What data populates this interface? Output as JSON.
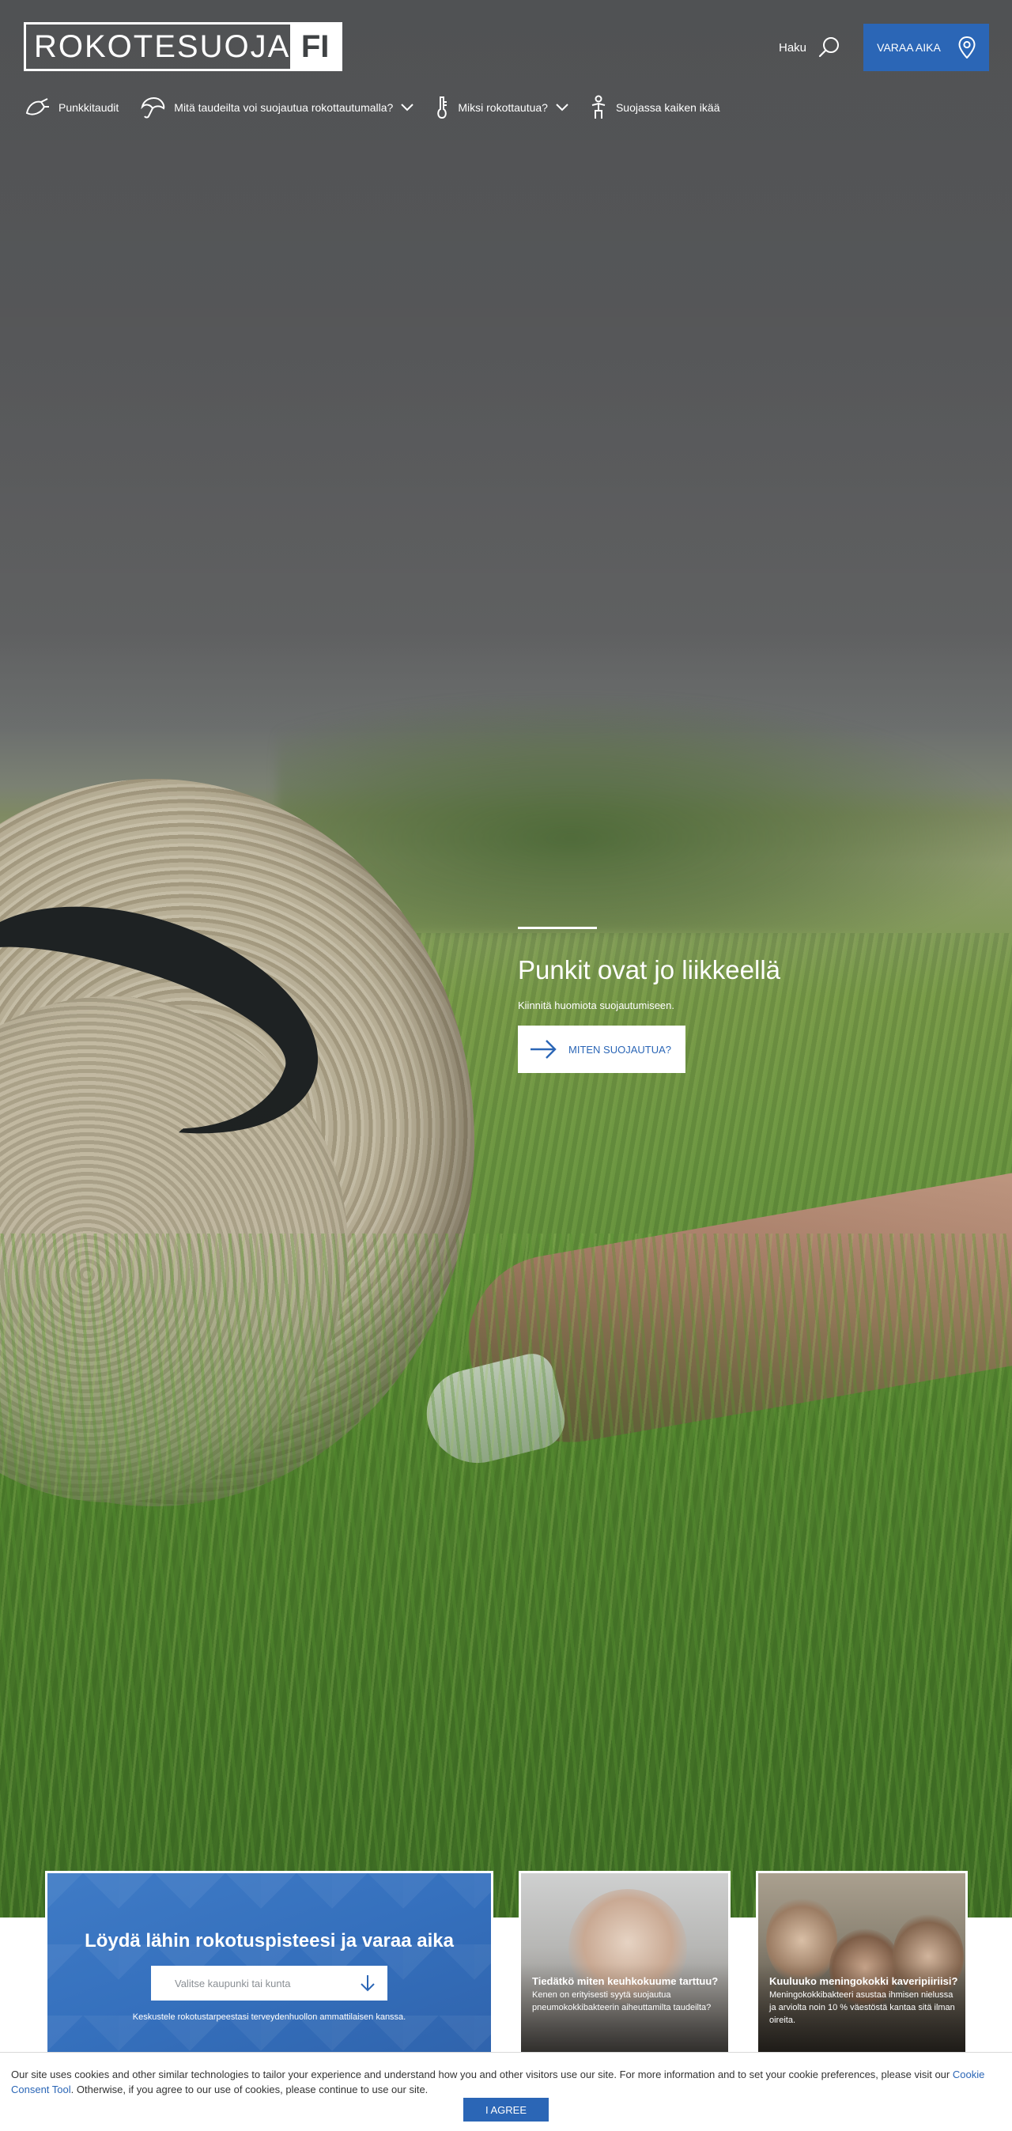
{
  "header": {
    "logo_text": "ROKOTESUOJA",
    "logo_suffix": "FI",
    "search_label": "Haku",
    "book_button_label": "VARAA AIKA"
  },
  "nav": {
    "items": [
      {
        "label": "Punkkitaudit",
        "icon": "tick-icon"
      },
      {
        "label": "Mitä taudeilta voi suojautua rokottautumalla?",
        "icon": "umbrella-icon",
        "has_dropdown": true
      },
      {
        "label": "Miksi rokottautua?",
        "icon": "thermometer-icon",
        "has_dropdown": true
      },
      {
        "label": "Suojassa kaiken ikää",
        "icon": "person-icon"
      }
    ]
  },
  "hero": {
    "title": "Punkit ovat jo liikkeellä",
    "subtitle": "Kiinnitä huomiota suojautumiseen.",
    "cta_label": "MITEN SUOJAUTUA?"
  },
  "finder": {
    "title": "Löydä lähin rokotuspisteesi ja varaa aika",
    "select_placeholder": "Valitse kaupunki tai kunta",
    "note": "Keskustele rokotustarpeestasi terveydenhuollon ammattilaisen kanssa."
  },
  "cards": [
    {
      "title": "Tiedätkö miten keuhkokuume tarttuu?",
      "body": "Kenen on erityisesti syytä suojautua pneumokokkibakteerin aiheuttamilta taudeilta?"
    },
    {
      "title": "Kuuluuko meningokokki kaveripiiriisi?",
      "body": "Meningokokkibakteeri asustaa ihmisen nielussa ja arviolta noin 10 % väestöstä kantaa sitä ilman oireita."
    }
  ],
  "cookie": {
    "text_before_link": "Our site uses cookies and other similar technologies to tailor your experience and understand how you and other visitors use our site. For more information and to set your cookie preferences, please visit our ",
    "link_label": "Cookie Consent Tool",
    "text_after_link": ". Otherwise, if you agree to our use of cookies, please continue to use our site.",
    "agree_label": "I AGREE"
  },
  "colors": {
    "brand_blue": "#2b66b6",
    "white": "#ffffff"
  }
}
